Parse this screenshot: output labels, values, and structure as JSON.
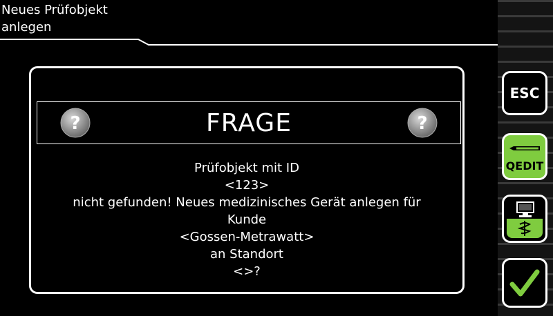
{
  "header": {
    "title_line1": "Neues Prüfobjekt",
    "title_line2": "anlegen"
  },
  "sidebar": {
    "esc_label": "ESC",
    "qedit_label": "QEDIT",
    "accent_color": "#7fcc3f"
  },
  "dialog": {
    "title": "FRAGE",
    "lines": [
      "Prüfobjekt mit ID",
      "<123>",
      "nicht gefunden! Neues medizinisches Gerät anlegen für",
      "Kunde",
      "<Gossen-Metrawatt>",
      "an Standort",
      "<>?"
    ]
  },
  "icons": {
    "question": "question-icon",
    "pen": "pen-icon",
    "computer": "computer-icon",
    "medical": "caduceus-icon",
    "confirm": "checkmark-icon"
  }
}
